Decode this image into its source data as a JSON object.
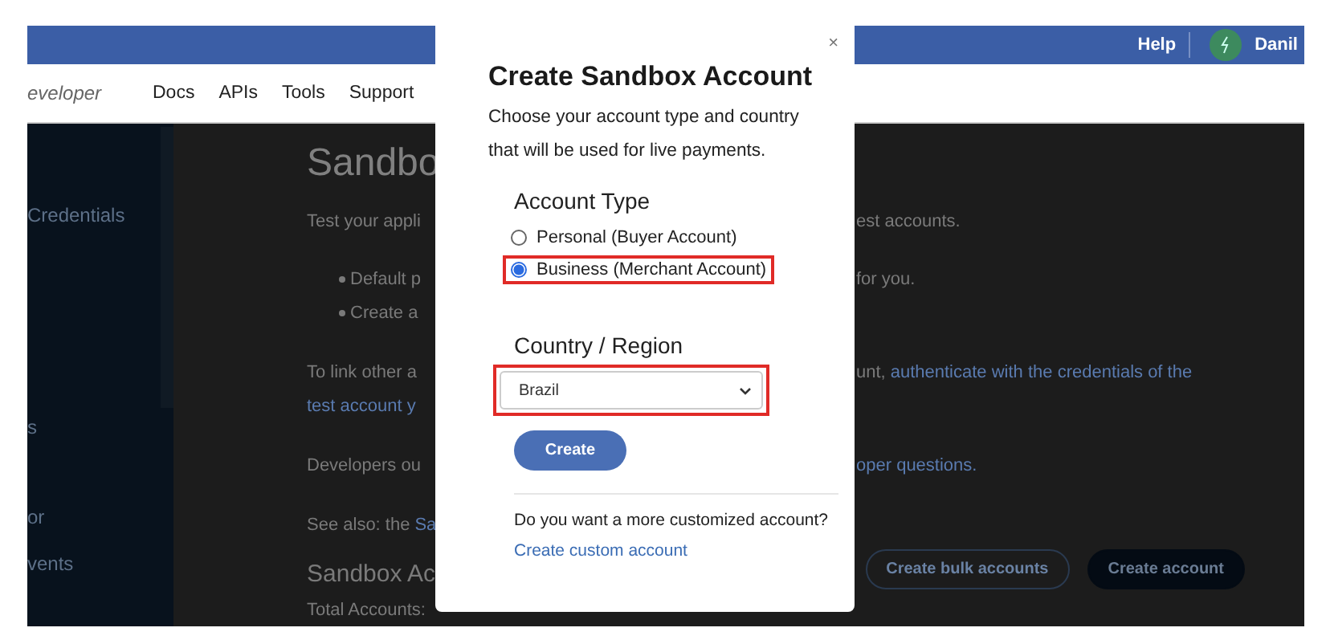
{
  "header": {
    "help": "Help",
    "user": "Danil"
  },
  "nav": {
    "brand": "eveloper",
    "items": [
      "Docs",
      "APIs",
      "Tools",
      "Support"
    ]
  },
  "sidebar": {
    "items": [
      "Credentials",
      "s",
      "or",
      "vents"
    ]
  },
  "main": {
    "rows": [
      {
        "kind": "heading",
        "left": "Sandbo"
      },
      {
        "kind": "text",
        "left": "Test your appli",
        "right": "est accounts."
      },
      {
        "kind": "bullet",
        "left": "Default p",
        "right": "for you."
      },
      {
        "kind": "bullet",
        "left": "Create a"
      },
      {
        "kind": "text",
        "left": "To link other a",
        "right": "unt,",
        "right_link": "authenticate with the credentials of the"
      },
      {
        "kind": "text",
        "left_link": "test account y"
      },
      {
        "kind": "text",
        "left": "Developers ou",
        "right_link": "oper questions."
      },
      {
        "kind": "text",
        "left": "See also: the",
        "left_link": "Sa"
      },
      {
        "kind": "subheading",
        "left": "Sandbox Ac"
      },
      {
        "kind": "text",
        "left": "Total Accounts:"
      }
    ],
    "buttons": [
      {
        "label": "Create bulk accounts",
        "kind": "outline"
      },
      {
        "label": "Create account",
        "kind": "filled"
      }
    ]
  },
  "modal": {
    "close": "×",
    "title": "Create Sandbox Account",
    "description": "Choose your account type and country that will be used for live payments.",
    "account_type": {
      "label": "Account Type",
      "options": [
        {
          "label": "Personal (Buyer Account)",
          "selected": false,
          "highlighted": false
        },
        {
          "label": "Business (Merchant Account)",
          "selected": true,
          "highlighted": true
        }
      ]
    },
    "country": {
      "label": "Country / Region",
      "value": "Brazil",
      "highlighted": true
    },
    "create_button": "Create",
    "footer_question": "Do you want a more customized account?",
    "footer_link": "Create custom account"
  }
}
